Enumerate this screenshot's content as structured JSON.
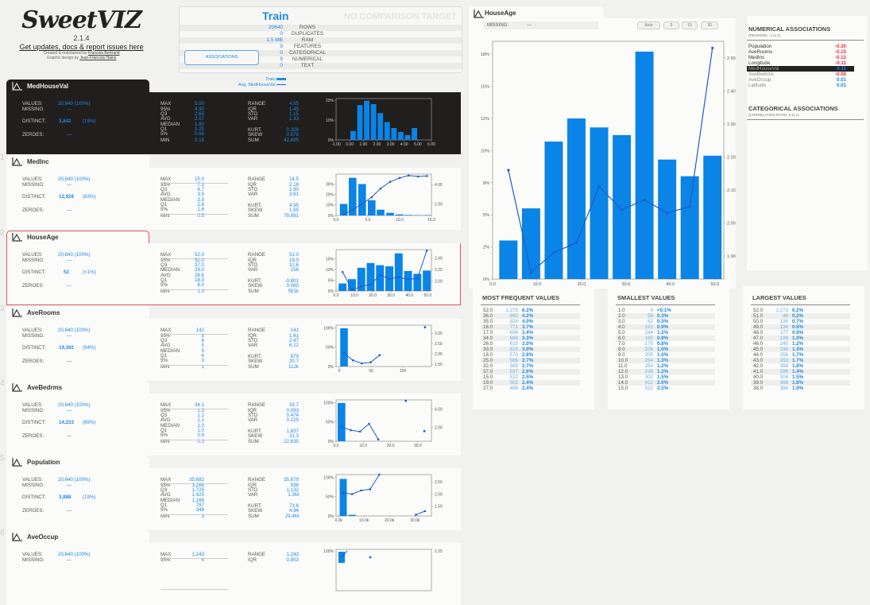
{
  "app": {
    "logo": "SweetVIZ",
    "version": "2.1.4",
    "updates_link": "Get updates, docs & report issues here",
    "credit1_prefix": "Created & maintained by ",
    "credit1_name": "Francois Bertrand",
    "credit2_prefix": "Graphic design by ",
    "credit2_name": "Jean-Francois Hains"
  },
  "summary": {
    "title": "Train",
    "comparison": "NO COMPARISON TARGET",
    "associations_button": "ASSOCIATIONS",
    "rows": [
      {
        "value": "20640",
        "label": "ROWS"
      },
      {
        "value": "0",
        "label": "DUPLICATES"
      },
      {
        "value": "1.5 MB",
        "label": "RAM"
      },
      {
        "value": "9",
        "label": "FEATURES"
      },
      {
        "value": "0",
        "label": "CATEGORICAL"
      },
      {
        "value": "9",
        "label": "NUMERICAL"
      },
      {
        "value": "0",
        "label": "TEXT"
      }
    ],
    "legend_train": "Train",
    "legend_avg": "Avg. MedHouseVal"
  },
  "colors": {
    "accent": "#1f8ae0",
    "negative": "#e8323c",
    "selected_border": "#e2535a",
    "dark_bg": "#211e1e"
  },
  "labels": {
    "values": "VALUES:",
    "missing": "MISSING:",
    "distinct": "DISTINCT:",
    "zeroes": "ZEROES:",
    "max": "MAX",
    "p95": "95%",
    "q3": "Q3",
    "avg": "AVG",
    "median": "MEDIAN",
    "q1": "Q1",
    "p5": "5%",
    "min": "MIN",
    "range": "RANGE",
    "iqr": "IQR",
    "std": "STD",
    "var": "VAR",
    "kurt": "KURT.",
    "skew": "SKEW",
    "sum": "SUM"
  },
  "features": [
    {
      "index": "",
      "name": "MedHouseVal",
      "style": "dark",
      "values": "20,640 (100%)",
      "missing": "—",
      "distinct": "3,842",
      "distinct_pct": "(19%)",
      "zeroes": "—",
      "max": "5.00",
      "p95": "4.90",
      "q3": "2.65",
      "avg": "2.07",
      "median": "1.80",
      "q1": "1.20",
      "p5": "0.66",
      "min": "0.15",
      "range": "4.85",
      "iqr": "1.45",
      "std": "1.15",
      "var": "1.33",
      "kurt": "0.328",
      "skew": "0.978",
      "sum": "42,695",
      "order": [
        "max",
        "p95",
        "q3",
        "avg",
        "median",
        "q1",
        "p5",
        "min"
      ],
      "chart": {
        "x_ticks": [
          "-1.00",
          "0.00",
          "1.00",
          "2.00",
          "3.00",
          "4.00",
          "5.00",
          "6.00"
        ],
        "x_range": [
          -1,
          6
        ],
        "y_ticks": [
          "0%",
          "10%",
          "20%"
        ],
        "y_max": 20,
        "bins": [
          [
            0.25,
            4.5
          ],
          [
            0.75,
            17.5
          ],
          [
            1.25,
            19.7
          ],
          [
            1.75,
            18
          ],
          [
            2.25,
            13.5
          ],
          [
            2.75,
            9
          ],
          [
            3.25,
            6
          ],
          [
            3.75,
            4
          ],
          [
            4.25,
            2.5
          ],
          [
            4.75,
            6
          ]
        ],
        "bin_w": 0.4,
        "line": null
      }
    },
    {
      "index": "1",
      "name": "MedInc",
      "style": "light",
      "values": "20,640 (100%)",
      "missing": "—",
      "distinct": "12,928",
      "distinct_pct": "(63%)",
      "zeroes": "—",
      "max": "15.0",
      "p95": "7.3",
      "q3": "4.7",
      "avg": "3.9",
      "median": "3.5",
      "q1": "2.6",
      "p5": "1.6",
      "min": "0.5",
      "range": "14.5",
      "iqr": "2.18",
      "std": "1.90",
      "var": "3.61",
      "kurt": "4.95",
      "skew": "1.65",
      "sum": "79,891",
      "order": [
        "max",
        "p95",
        "q3",
        "avg",
        "median",
        "q1",
        "p5",
        "min"
      ],
      "chart": {
        "x_ticks": [
          "0.0",
          "5.0",
          "10.0",
          "15.0"
        ],
        "x_range": [
          0,
          15
        ],
        "y_ticks": [
          "0%",
          "10%",
          "20%",
          "30%"
        ],
        "y_max": 38,
        "bins": [
          [
            1.2,
            11
          ],
          [
            2.6,
            36
          ],
          [
            4.1,
            30
          ],
          [
            5.6,
            14.5
          ],
          [
            7.0,
            5.5
          ],
          [
            8.5,
            2.5
          ],
          [
            10.0,
            1
          ],
          [
            11.4,
            0.5
          ],
          [
            12.9,
            0.3
          ],
          [
            14.3,
            0.4
          ]
        ],
        "bin_w": 1.2,
        "y2_ticks": [
          "2.00",
          "4.00"
        ],
        "y2_range": [
          0.8,
          5.1
        ],
        "line": [
          [
            1.2,
            0.9
          ],
          [
            2.6,
            1.4
          ],
          [
            4.1,
            2.0
          ],
          [
            5.6,
            2.7
          ],
          [
            7.0,
            3.6
          ],
          [
            8.5,
            4.3
          ],
          [
            10.0,
            4.7
          ],
          [
            11.4,
            4.95
          ],
          [
            12.9,
            4.85
          ],
          [
            14.3,
            4.9
          ]
        ]
      }
    },
    {
      "index": "2",
      "name": "HouseAge",
      "style": "selected",
      "values": "20,640 (100%)",
      "missing": "—",
      "distinct": "52",
      "distinct_pct": "(<1%)",
      "zeroes": "—",
      "max": "52.0",
      "p95": "52.0",
      "q3": "37.0",
      "median": "29.0",
      "avg": "28.6",
      "q1": "18.0",
      "p5": "8.0",
      "min": "1.0",
      "range": "51.0",
      "iqr": "19.0",
      "std": "12.6",
      "var": "158",
      "kurt": "-0.801",
      "skew": "0.060",
      "sum": "591k",
      "order": [
        "max",
        "p95",
        "q3",
        "median",
        "avg",
        "q1",
        "p5",
        "min"
      ],
      "chart": {
        "x_ticks": [
          "0.0",
          "10.0",
          "20.0",
          "30.0",
          "40.0",
          "50.0"
        ],
        "x_range": [
          0,
          52
        ],
        "y_ticks": [
          "0%",
          "5%",
          "10%",
          "15%"
        ],
        "y_max": 18.5,
        "bins": [
          [
            3.55,
            3.5
          ],
          [
            8.65,
            5.5
          ],
          [
            13.75,
            10.8
          ],
          [
            18.85,
            13
          ],
          [
            23.95,
            12
          ],
          [
            29.05,
            11.5
          ],
          [
            34.15,
            17.5
          ],
          [
            39.25,
            9.3
          ],
          [
            44.35,
            8
          ],
          [
            49.45,
            9.5
          ]
        ],
        "bin_w": 4.3,
        "y2_ticks": [
          "2.00",
          "2.20",
          "2.40"
        ],
        "y2_range": [
          1.83,
          2.55
        ],
        "line": [
          [
            3.55,
            2.16
          ],
          [
            8.65,
            1.85
          ],
          [
            13.75,
            1.91
          ],
          [
            18.85,
            1.94
          ],
          [
            23.95,
            2.11
          ],
          [
            29.05,
            2.04
          ],
          [
            34.15,
            2.07
          ],
          [
            39.25,
            2.03
          ],
          [
            44.35,
            2.05
          ],
          [
            49.45,
            2.53
          ]
        ]
      }
    },
    {
      "index": "3",
      "name": "AveRooms",
      "style": "light",
      "values": "20,640 (100%)",
      "missing": "—",
      "distinct": "19,392",
      "distinct_pct": "(94%)",
      "zeroes": "—",
      "max": "142",
      "p95": "8",
      "q3": "6",
      "avg": "5",
      "median": "5",
      "q1": "4",
      "p5": "3",
      "min": "1",
      "range": "141",
      "iqr": "1.61",
      "std": "2.47",
      "var": "6.12",
      "kurt": "879",
      "skew": "20.7",
      "sum": "112k",
      "order": [
        "max",
        "p95",
        "q3",
        "avg",
        "median",
        "q1",
        "p5",
        "min"
      ],
      "chart": {
        "x_ticks": [
          "0",
          "50",
          "100"
        ],
        "x_range": [
          -5,
          145
        ],
        "y_ticks": [
          "0%",
          "50%",
          "100%"
        ],
        "y_max": 103,
        "bins": [
          [
            7.5,
            99
          ]
        ],
        "bin_w": 12,
        "y2_ticks": [
          "1.50",
          "2.00",
          "2.50",
          "3.00"
        ],
        "y2_range": [
          1.4,
          3.4
        ],
        "line": [
          [
            7.5,
            2.05
          ],
          [
            21.5,
            1.7
          ],
          [
            35.5,
            1.55
          ],
          [
            49.5,
            1.6
          ],
          [
            63.5,
            1.95
          ]
        ],
        "extra_points": [
          [
            135,
            3.3
          ]
        ]
      }
    },
    {
      "index": "4",
      "name": "AveBedrms",
      "style": "light",
      "values": "20,640 (100%)",
      "missing": "—",
      "distinct": "14,233",
      "distinct_pct": "(69%)",
      "zeroes": "—",
      "max": "34.1",
      "p95": "1.3",
      "q3": "1.1",
      "avg": "1.1",
      "median": "1.0",
      "q1": "1.0",
      "p5": "0.9",
      "min": "0.3",
      "range": "33.7",
      "iqr": "0.093",
      "std": "0.474",
      "var": "0.225",
      "kurt": "1,637",
      "skew": "31.3",
      "sum": "22,635",
      "order": [
        "max",
        "p95",
        "q3",
        "avg",
        "median",
        "q1",
        "p5",
        "min"
      ],
      "chart": {
        "x_ticks": [
          "0.0",
          "10.0",
          "20.0",
          "30.0"
        ],
        "x_range": [
          0,
          35
        ],
        "y_ticks": [
          "0%",
          "50%",
          "100%"
        ],
        "y_max": 103,
        "bins": [
          [
            2.0,
            99
          ]
        ],
        "bin_w": 2.8,
        "y2_ticks": [
          "2.00",
          "4.00"
        ],
        "y2_range": [
          0.5,
          5.0
        ],
        "line": [
          [
            2.0,
            2.05
          ],
          [
            5.4,
            1.7
          ],
          [
            8.8,
            1.55
          ],
          [
            12.1,
            2.4
          ],
          [
            15.5,
            0.7
          ]
        ],
        "extra_points": [
          [
            25.6,
            4.9
          ],
          [
            32.4,
            1.6
          ]
        ]
      }
    },
    {
      "index": "5",
      "name": "Population",
      "style": "light",
      "values": "20,640 (100%)",
      "missing": "—",
      "distinct": "3,888",
      "distinct_pct": "(19%)",
      "zeroes": "—",
      "max": "35,682",
      "p95": "3,288",
      "q3": "1,725",
      "avg": "1,425",
      "median": "1,166",
      "q1": "787",
      "p5": "348",
      "min": "3",
      "range": "35,679",
      "iqr": "938",
      "std": "1,132",
      "var": "1.3M",
      "kurt": "73.6",
      "skew": "4.94",
      "sum": "29.4M",
      "order": [
        "max",
        "p95",
        "q3",
        "avg",
        "median",
        "q1",
        "p5",
        "min"
      ],
      "chart": {
        "x_ticks": [
          "0.0k",
          "10.0k",
          "20.0k",
          "30.0k"
        ],
        "x_range": [
          -1000,
          36500
        ],
        "y_ticks": [
          "0%",
          "50%",
          "100%"
        ],
        "y_max": 103,
        "bins": [
          [
            1800,
            96
          ],
          [
            5300,
            3
          ]
        ],
        "bin_w": 2800,
        "y2_ticks": [
          "1.50",
          "2.00",
          "2.50"
        ],
        "y2_range": [
          1.1,
          2.8
        ],
        "line": [
          [
            1800,
            2.05
          ],
          [
            5300,
            2.0
          ],
          [
            8900,
            2.15
          ],
          [
            12400,
            2.2
          ],
          [
            16000,
            2.8
          ]
        ],
        "extra_points_line": [
          [
            30400,
            1.15
          ],
          [
            34000,
            1.3
          ]
        ]
      }
    },
    {
      "index": "6",
      "name": "AveOccup",
      "style": "light",
      "values": "20,640 (100%)",
      "missing": "—",
      "max": "1,243",
      "p95": "4",
      "range": "1,243",
      "iqr": "0.853",
      "order": [
        "max",
        "p95"
      ],
      "chart": {
        "y_ticks": [
          "100%"
        ],
        "y2_ticks": [
          "2.25"
        ]
      }
    }
  ],
  "detail": {
    "title": "HouseAge",
    "missing_label": "MISSING:",
    "missing_value": "—",
    "bin_buttons": [
      "Auto",
      "5",
      "15",
      "30"
    ]
  },
  "chart_data": {
    "type": "bar",
    "title": "HouseAge",
    "categories": [
      "3.55",
      "8.65",
      "13.75",
      "18.85",
      "23.95",
      "29.05",
      "34.15",
      "39.25",
      "44.35",
      "49.45"
    ],
    "x_ticks": [
      "0.0",
      "10.0",
      "20.0",
      "30.0",
      "40.0",
      "50.0"
    ],
    "x_range": [
      0,
      52
    ],
    "y_ticks": [
      "0%",
      "2%",
      "5%",
      "8%",
      "10%",
      "12%",
      "15%",
      "18%"
    ],
    "ylim": [
      0,
      18.5
    ],
    "y2_ticks": [
      "1.90",
      "2.00",
      "2.10",
      "2.20",
      "2.30",
      "2.40",
      "2.50"
    ],
    "y2lim": [
      1.83,
      2.55
    ],
    "series": [
      {
        "name": "Train",
        "type": "bar",
        "values": [
          3.0,
          5.5,
          10.7,
          12.5,
          11.8,
          11.2,
          17.7,
          9.3,
          8.0,
          9.6
        ]
      },
      {
        "name": "Avg. MedHouseVal",
        "type": "line",
        "values": [
          2.16,
          1.85,
          1.91,
          1.94,
          2.11,
          2.04,
          2.07,
          2.03,
          2.05,
          2.53
        ]
      }
    ],
    "xlabel": "",
    "ylabel": ""
  },
  "most_frequent": {
    "title": "MOST FREQUENT VALUES",
    "rows": [
      [
        "52.0",
        "1,273",
        "6.2%"
      ],
      [
        "36.0",
        "862",
        "4.2%"
      ],
      [
        "35.0",
        "824",
        "4.0%"
      ],
      [
        "16.0",
        "771",
        "3.7%"
      ],
      [
        "17.0",
        "698",
        "3.4%"
      ],
      [
        "34.0",
        "689",
        "3.3%"
      ],
      [
        "26.0",
        "619",
        "3.0%"
      ],
      [
        "33.0",
        "615",
        "3.0%"
      ],
      [
        "18.0",
        "570",
        "2.8%"
      ],
      [
        "25.0",
        "566",
        "2.7%"
      ],
      [
        "32.0",
        "565",
        "2.7%"
      ],
      [
        "37.0",
        "537",
        "2.6%"
      ],
      [
        "15.0",
        "512",
        "2.5%"
      ],
      [
        "19.0",
        "502",
        "2.4%"
      ],
      [
        "27.0",
        "488",
        "2.4%"
      ]
    ]
  },
  "smallest": {
    "title": "SMALLEST VALUES",
    "rows": [
      [
        "1.0",
        "4",
        "<0.1%"
      ],
      [
        "2.0",
        "58",
        "0.3%"
      ],
      [
        "3.0",
        "62",
        "0.3%"
      ],
      [
        "4.0",
        "191",
        "0.9%"
      ],
      [
        "5.0",
        "244",
        "1.2%"
      ],
      [
        "6.0",
        "160",
        "0.8%"
      ],
      [
        "7.0",
        "175",
        "0.8%"
      ],
      [
        "8.0",
        "206",
        "1.0%"
      ],
      [
        "9.0",
        "205",
        "1.0%"
      ],
      [
        "10.0",
        "264",
        "1.3%"
      ],
      [
        "11.0",
        "254",
        "1.2%"
      ],
      [
        "12.0",
        "238",
        "1.2%"
      ],
      [
        "13.0",
        "302",
        "1.5%"
      ],
      [
        "14.0",
        "412",
        "2.0%"
      ],
      [
        "15.0",
        "512",
        "2.5%"
      ]
    ]
  },
  "largest": {
    "title": "LARGEST VALUES",
    "rows": [
      [
        "52.0",
        "1,273",
        "6.2%"
      ],
      [
        "51.0",
        "48",
        "0.2%"
      ],
      [
        "50.0",
        "136",
        "0.7%"
      ],
      [
        "49.0",
        "134",
        "0.6%"
      ],
      [
        "48.0",
        "177",
        "0.9%"
      ],
      [
        "47.0",
        "198",
        "1.0%"
      ],
      [
        "46.0",
        "245",
        "1.2%"
      ],
      [
        "45.0",
        "294",
        "1.4%"
      ],
      [
        "44.0",
        "356",
        "1.7%"
      ],
      [
        "43.0",
        "353",
        "1.7%"
      ],
      [
        "42.0",
        "368",
        "1.8%"
      ],
      [
        "41.0",
        "296",
        "1.4%"
      ],
      [
        "40.0",
        "304",
        "1.5%"
      ],
      [
        "39.0",
        "369",
        "1.8%"
      ],
      [
        "38.0",
        "394",
        "1.9%"
      ]
    ]
  },
  "associations": {
    "numerical_title": "NUMERICAL ASSOCIATIONS",
    "numerical_sub": "(PEARSON, -1 to 1)",
    "rows": [
      {
        "name": "Population",
        "value": "-0.30",
        "neg": true
      },
      {
        "name": "AveRooms",
        "value": "-0.15",
        "neg": true
      },
      {
        "name": "MedInc",
        "value": "-0.12",
        "neg": true
      },
      {
        "name": "Longitude",
        "value": "-0.11",
        "neg": true
      },
      {
        "name": "MedHouseVal",
        "value": "0.11",
        "neg": false,
        "highlight": true
      },
      {
        "name": "AveBedrms",
        "value": "-0.08",
        "neg": true
      },
      {
        "name": "AveOccup",
        "value": "0.01",
        "neg": false
      },
      {
        "name": "Latitude",
        "value": "0.01",
        "neg": false
      }
    ],
    "categorical_title": "CATEGORICAL ASSOCIATIONS",
    "categorical_sub": "(CORRELATION RATIO, 0 to 1)"
  }
}
